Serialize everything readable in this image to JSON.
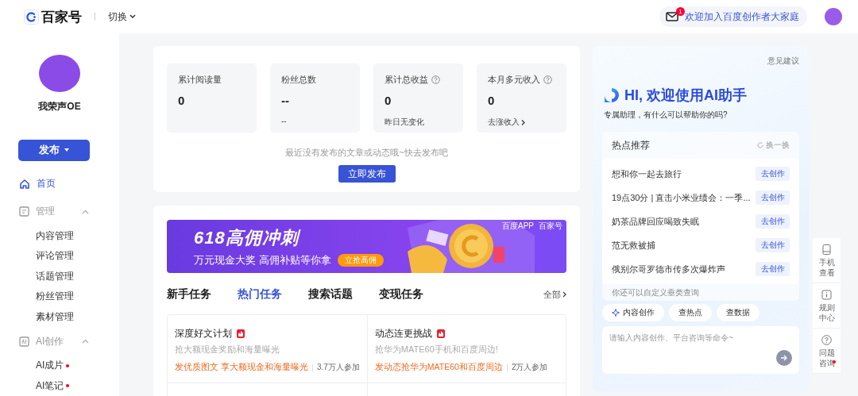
{
  "header": {
    "logo_text": "百家号",
    "switch": "切换",
    "mail_badge": "1",
    "welcome": "欢迎加入百度创作者大家庭"
  },
  "sidebar": {
    "username": "我荣声OE",
    "publish_button": "发布",
    "nav": [
      {
        "kind": "link",
        "label": "首页",
        "selected": true
      },
      {
        "kind": "group",
        "label": "管理",
        "expanded": true,
        "children": [
          {
            "label": "内容管理",
            "dot": false
          },
          {
            "label": "评论管理",
            "dot": false
          },
          {
            "label": "话题管理",
            "dot": false
          },
          {
            "label": "粉丝管理",
            "dot": false
          },
          {
            "label": "素材管理",
            "dot": false
          }
        ]
      },
      {
        "kind": "group",
        "label": "AI创作",
        "expanded": true,
        "children": [
          {
            "label": "AI成片",
            "dot": true
          },
          {
            "label": "AI笔记",
            "dot": true
          }
        ]
      }
    ]
  },
  "stats": {
    "cards": [
      {
        "label": "累计阅读量",
        "value": "0",
        "help": false
      },
      {
        "label": "粉丝总数",
        "value": "--",
        "help": false,
        "note": "--"
      },
      {
        "label": "累计总收益",
        "value": "0",
        "help": true,
        "note": "昨日无变化"
      },
      {
        "label": "本月多元收入",
        "value": "0",
        "help": true,
        "note": "去涨收入",
        "link": true
      }
    ],
    "empty_text": "最近没有发布的文章或动态哦~快去发布吧",
    "publish_now": "立即发布"
  },
  "banner": {
    "title": "618高佣冲刺",
    "subtitle": "万元现金大奖 高佣补贴等你拿",
    "button": "立抢高佣",
    "brands": [
      "百度APP",
      "百家号"
    ]
  },
  "tasks": {
    "tabs": [
      {
        "label": "新手任务",
        "selected": false
      },
      {
        "label": "热门任务",
        "selected": true
      },
      {
        "label": "搜索话题",
        "selected": false
      },
      {
        "label": "变现任务",
        "selected": false
      }
    ],
    "all_link": "全部",
    "cards": [
      {
        "title": "深度好文计划",
        "hot": true,
        "desc": "抢大额现金奖励和海量曝光",
        "promo": "发优质图文 享大额现金和海量曝光",
        "count": "3.7万人参加"
      },
      {
        "title": "动态连更挑战",
        "hot": true,
        "desc": "抢华为MATE60手机和百度周边!",
        "promo": "发动态抢华为MATE60和百度周边",
        "count": "2万人参加"
      }
    ]
  },
  "assistant": {
    "feedback": "意见建议",
    "title": "HI, 欢迎使用AI助手",
    "subtitle": "专属助理，有什么可以帮助你的吗?",
    "hot": {
      "title": "热点推荐",
      "refresh": "换一换",
      "items": [
        {
          "text": "想和你一起去旅行",
          "action": "去创作"
        },
        {
          "text": "19点30分 | 直击小米业绩会：一季...",
          "action": "去创作"
        },
        {
          "text": "奶茶品牌回应喝致失眠",
          "action": "去创作"
        },
        {
          "text": "范无救被捕",
          "action": "去创作"
        },
        {
          "text": "俄别尔哥罗德市传多次爆炸声",
          "action": "去创作"
        }
      ],
      "hint": "你还可以自定义垂类查询"
    },
    "chips": [
      {
        "label": "内容创作",
        "icon": true
      },
      {
        "label": "查热点",
        "icon": false
      },
      {
        "label": "查数据",
        "icon": false
      }
    ],
    "input_placeholder": "请输入内容创作、平台咨询等命令~"
  },
  "side_tools": [
    {
      "kind": "phone",
      "label": "手机查看",
      "dot": false
    },
    {
      "kind": "info",
      "label": "规则中心",
      "dot": false
    },
    {
      "kind": "help",
      "label": "问题咨询",
      "dot": true
    }
  ]
}
